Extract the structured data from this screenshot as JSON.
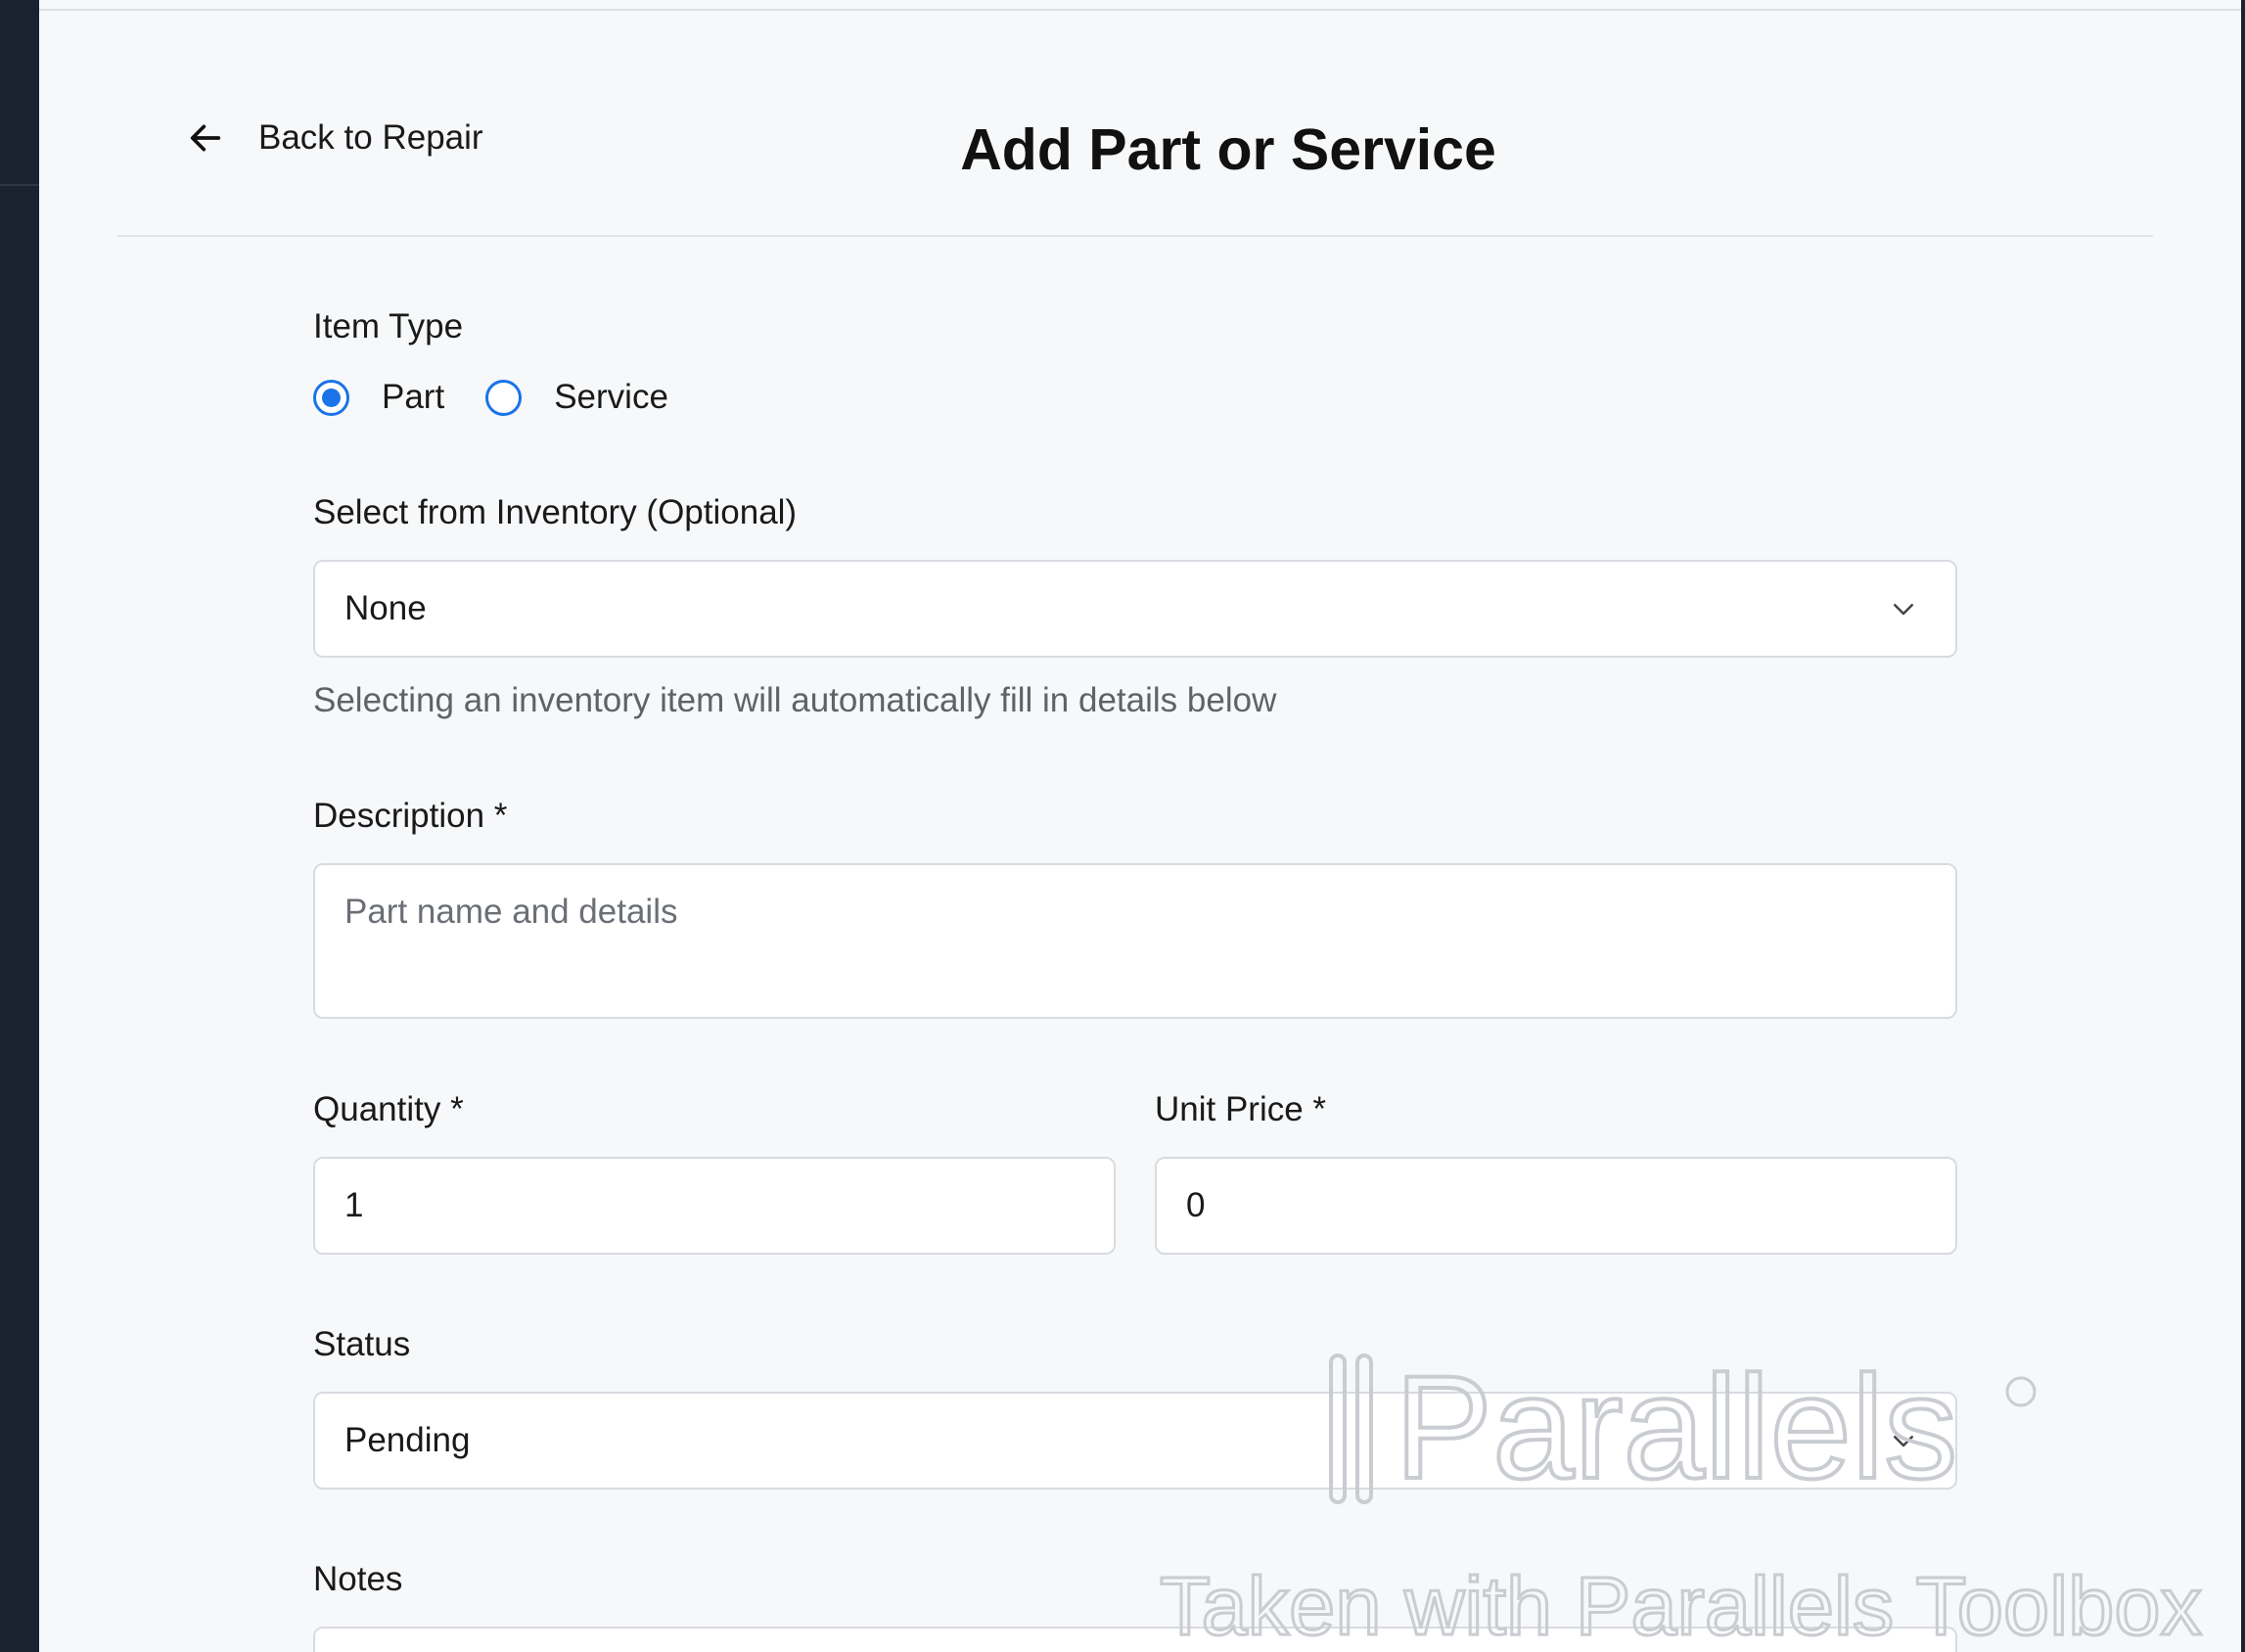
{
  "header": {
    "back_label": "Back to Repair",
    "title": "Add Part or Service"
  },
  "form": {
    "item_type": {
      "label": "Item Type",
      "options": [
        {
          "label": "Part",
          "checked": true
        },
        {
          "label": "Service",
          "checked": false
        }
      ]
    },
    "inventory": {
      "label": "Select from Inventory (Optional)",
      "value": "None",
      "helper": "Selecting an inventory item will automatically fill in details below"
    },
    "description": {
      "label": "Description *",
      "placeholder": "Part name and details",
      "value": ""
    },
    "quantity": {
      "label": "Quantity *",
      "value": "1"
    },
    "unit_price": {
      "label": "Unit Price *",
      "value": "0"
    },
    "status": {
      "label": "Status",
      "value": "Pending"
    },
    "notes": {
      "label": "Notes"
    }
  },
  "watermark": {
    "logo_text": "Parallels",
    "caption": "Taken with Parallels Toolbox"
  },
  "colors": {
    "accent": "#1a73e8",
    "rail": "#1a2230",
    "background": "#f7f8fa"
  }
}
